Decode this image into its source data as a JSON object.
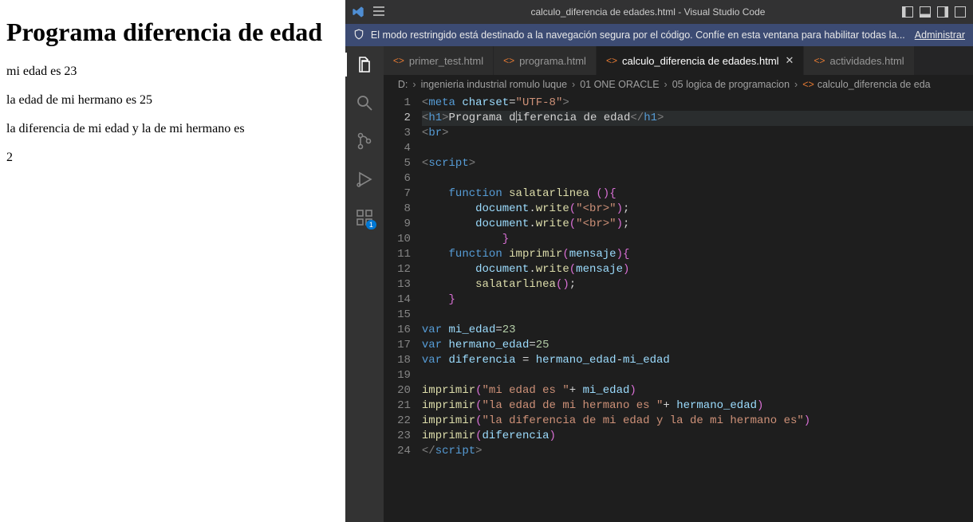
{
  "browser": {
    "heading": "Programa diferencia de edad",
    "p1": "mi edad es 23",
    "p2": "la edad de mi hermano es 25",
    "p3": "la diferencia de mi edad y la de mi hermano es",
    "p4": "2"
  },
  "titlebar": {
    "title": "calculo_diferencia de edades.html - Visual Studio Code"
  },
  "info_bar": {
    "text": "El modo restringido está destinado a la navegación segura por el código. Confíe en esta ventana para habilitar todas la...",
    "link": "Administrar"
  },
  "tabs": [
    {
      "label": "primer_test.html",
      "active": false
    },
    {
      "label": "programa.html",
      "active": false
    },
    {
      "label": "calculo_diferencia de edades.html",
      "active": true
    },
    {
      "label": "actividades.html",
      "active": false
    }
  ],
  "breadcrumb": {
    "drive": "D:",
    "p1": "ingenieria industrial romulo luque",
    "p2": "01 ONE ORACLE",
    "p3": "05 logica de programacion",
    "file": "calculo_diferencia de eda"
  },
  "code": {
    "lines": [
      {
        "n": 1,
        "kind": "meta"
      },
      {
        "n": 2,
        "kind": "h1"
      },
      {
        "n": 3,
        "kind": "br"
      },
      {
        "n": 4,
        "kind": "blank"
      },
      {
        "n": 5,
        "kind": "scriptopen"
      },
      {
        "n": 6,
        "kind": "blank"
      },
      {
        "n": 7,
        "kind": "fnstart",
        "name": "salatarlinea",
        "paren": "()"
      },
      {
        "n": 8,
        "kind": "docwrite"
      },
      {
        "n": 9,
        "kind": "docwrite"
      },
      {
        "n": 10,
        "kind": "closebrace_indent"
      },
      {
        "n": 11,
        "kind": "fnstart",
        "name": "imprimir",
        "param": "mensaje"
      },
      {
        "n": 12,
        "kind": "docwritemsg"
      },
      {
        "n": 13,
        "kind": "callsalat"
      },
      {
        "n": 14,
        "kind": "closebrace"
      },
      {
        "n": 15,
        "kind": "blank"
      },
      {
        "n": 16,
        "kind": "vardecl",
        "name": "mi_edad",
        "val": "23"
      },
      {
        "n": 17,
        "kind": "vardecl",
        "name": "hermano_edad",
        "val": "25"
      },
      {
        "n": 18,
        "kind": "vardiff"
      },
      {
        "n": 19,
        "kind": "blank"
      },
      {
        "n": 20,
        "kind": "imprimircall",
        "str": "mi edad es ",
        "var": "mi_edad"
      },
      {
        "n": 21,
        "kind": "imprimircall",
        "str": "la edad de mi hermano es ",
        "var": "hermano_edad"
      },
      {
        "n": 22,
        "kind": "imprimirstr",
        "str": "la diferencia de mi edad y la de mi hermano es"
      },
      {
        "n": 23,
        "kind": "imprimirvar",
        "var": "diferencia"
      },
      {
        "n": 24,
        "kind": "scriptclose"
      }
    ],
    "strings": {
      "meta_attr": "charset",
      "meta_val": "UTF-8",
      "h1_text": "Programa diferencia de edad",
      "brstr": "\"<br>\"",
      "diff_expr_a": "hermano_edad",
      "diff_expr_b": "mi_edad"
    }
  },
  "activitybar": {
    "items": [
      "explorer",
      "search",
      "source-control",
      "run-debug",
      "extensions"
    ]
  }
}
